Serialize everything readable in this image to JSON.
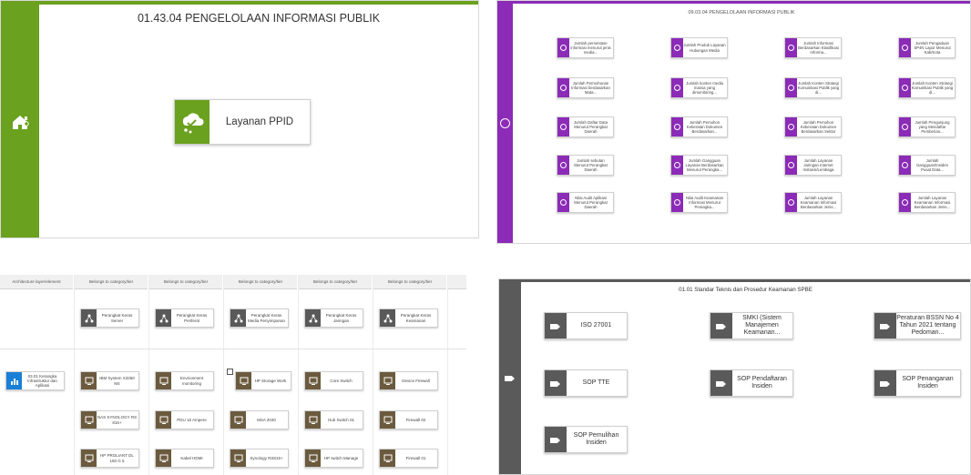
{
  "panel1": {
    "title": "01.43.04 PENGELOLAAN INFORMASI PUBLIK",
    "card_label": "Layanan PPID",
    "accent": "#6aa11e"
  },
  "panel2": {
    "title": "09.03.04 PENGELOLAAN INFORMASI PUBLIK",
    "accent": "#8b2bb7",
    "cards": [
      "Jumlah persentase informasi menurut jenis media...",
      "Jumlah Produk Layanan Hubungan Media",
      "Jumlah Informasi Berdasarkan Klasifikasi Informa...",
      "Jumlah Pengaduan SP4N Lapor Menurut Kab/Kota",
      "Jumlah Permohonan Informasi berdasarkan Mata...",
      "Jumlah konten media massa yang dimonitoring...",
      "Jumlah Konten Strategi Komunikasi Publik yang di...",
      "Jumlah Konten Strategi Komunikasi Publik yang di...",
      "Jumlah Daftar Data Menurut Perangkat Daerah",
      "Jumlah Pemohon Keberatan Dokumen Berdasarkan...",
      "Jumlah Pemohon Keberatan Dokumen Berdasarkan Sektor",
      "Jumlah Pengunjung yang Mendaftar Pemberian...",
      "Jumlah sebutan Menurut Perangkat Daerah",
      "Jumlah Gangguan Layanan Berdasarkan Menurut Perangka...",
      "Jumlah Layanan Jaringan Internet Instansi/Lembaga",
      "Jumlah Gangguan/Insiden Pusat Data...",
      "Nilai Audit Aplikasi Menurut Perangkat Daerah",
      "Nilai Audit Keamanan Informasi Menurut Perangka...",
      "Jumlah Layanan Keamanan Informasi Berdasarkan Jenis...",
      "Jumlah Layanan Keamanan Informasi Berdasarkan Jenis..."
    ]
  },
  "panel3": {
    "headers": [
      "Architecture layer/element",
      "Belongs to category/tier",
      "Belongs to category/tier",
      "Belongs to category/tier",
      "Belongs to category/tier",
      "Belongs to category/tier",
      "Belongs to category/tier"
    ],
    "categories": [
      "Perangkat Keras Server",
      "Perangkat Keras Periferal",
      "Perangkat Keras Media Penyimpanan",
      "Perangkat Keras Jaringan",
      "Perangkat Keras Keamanan"
    ],
    "app_label": "03.01 Kerangka Infrastruktur dan Aplikasi",
    "rows": [
      [
        "IBM System X3250 M4",
        "Environment monitoring",
        "HP Storage Work",
        "Core Switch",
        "Device Firewall"
      ],
      [
        "NAS SYNOLOGY RS 815+",
        "PDU 16 Ampere",
        "MSA 2040",
        "Hub Switch 01",
        "Firewall 02"
      ],
      [
        "HP PROLIANT DL 160 G 5",
        "Kabel HDMI",
        "Synology RS815+",
        "HP switch Manage",
        "Firewall 01"
      ]
    ]
  },
  "panel4": {
    "title": "01.01 Standar Teknis dan Prosedur Keamanan SPBE",
    "cards": [
      "ISO 27001",
      "SMKI (Sistem Manajemen Keamanan...",
      "Peraturan BSSN No 4 Tahun 2021 tentang Pedoman...",
      "SOP TTE",
      "SOP Pendaftaran Insiden",
      "SOP Penanganan Insiden",
      "SOP Pemulihan Insiden"
    ]
  }
}
